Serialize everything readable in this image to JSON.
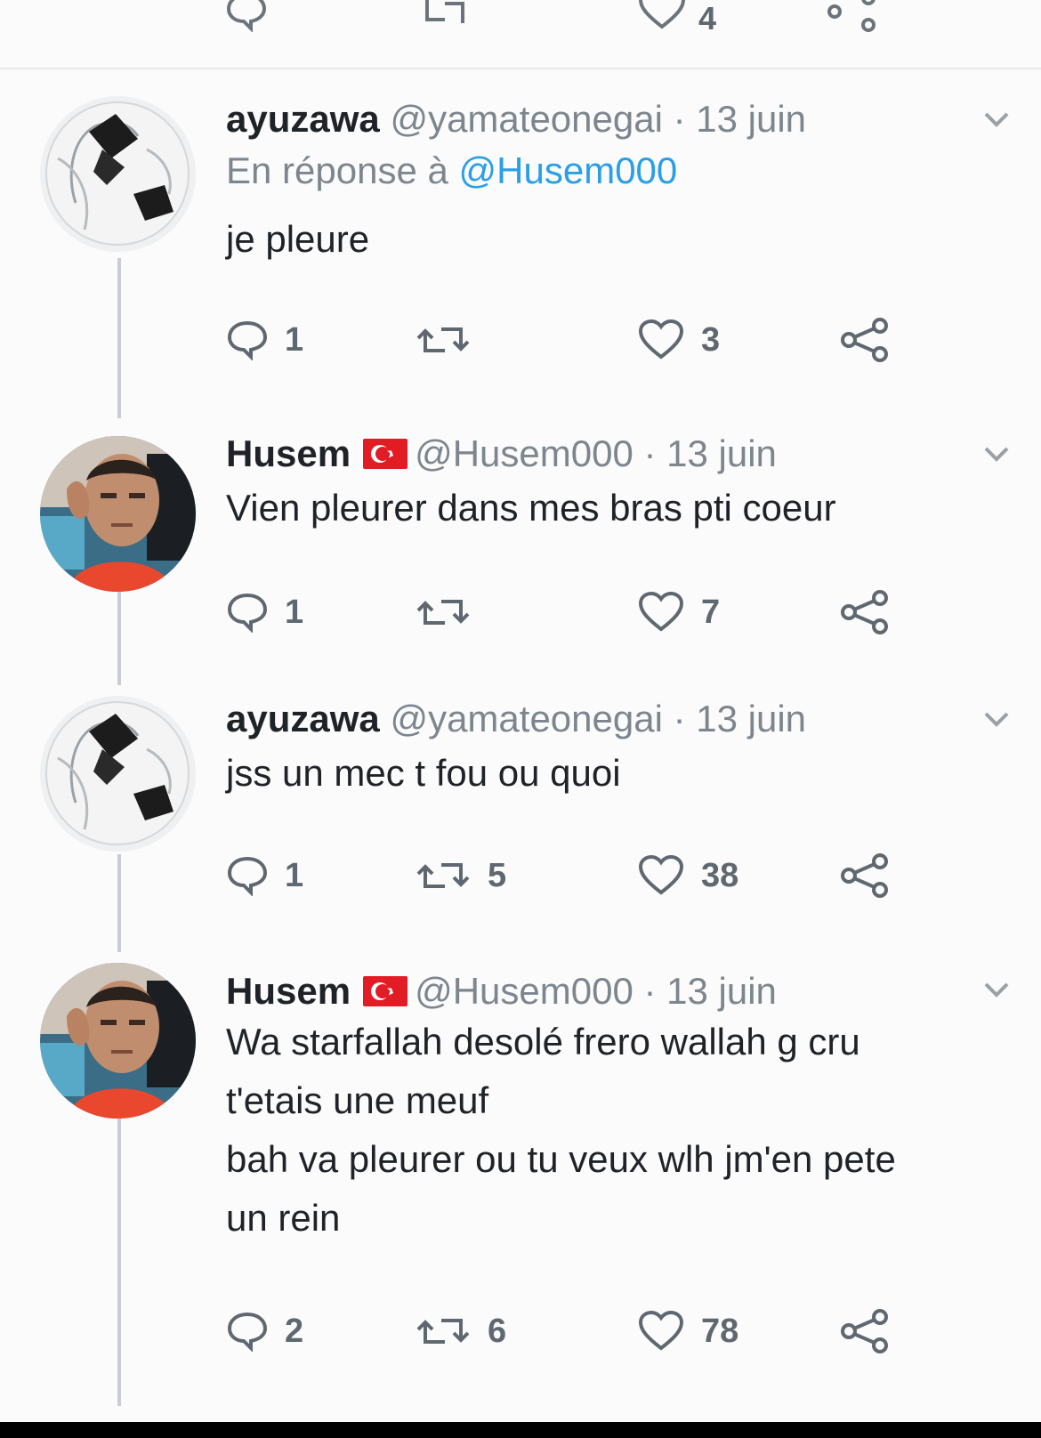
{
  "colors": {
    "text": "#1f2328",
    "muted": "#7d868e",
    "mention": "#2a9fe8",
    "thread_line": "#c9cdd1",
    "flag_red": "#e21c24"
  },
  "top_actions": {
    "like_count": "4"
  },
  "tweets": [
    {
      "name": "ayuzawa",
      "handle": "@yamateonegai",
      "date": "· 13 juin",
      "reply_prefix": "En réponse à",
      "reply_mention": "@Husem000",
      "text": "je pleure",
      "reply_count": "1",
      "retweet_count": "",
      "like_count": "3",
      "avatar": "anime-avatar"
    },
    {
      "name": "Husem",
      "flag": "turkey-flag-icon",
      "handle": "@Husem000",
      "date": "· 13 juin",
      "text": "Vien pleurer dans mes bras pti coeur",
      "reply_count": "1",
      "retweet_count": "",
      "like_count": "7",
      "avatar": "selfie-avatar"
    },
    {
      "name": "ayuzawa",
      "handle": "@yamateonegai",
      "date": "· 13 juin",
      "text": "jss un mec t fou ou quoi",
      "reply_count": "1",
      "retweet_count": "5",
      "like_count": "38",
      "avatar": "anime-avatar"
    },
    {
      "name": "Husem",
      "flag": "turkey-flag-icon",
      "handle": "@Husem000",
      "date": "· 13 juin",
      "text": "Wa starfallah desolé frero wallah g cru\nt'etais une meuf\nbah va pleurer ou tu veux wlh jm'en pete\nun rein",
      "reply_count": "2",
      "retweet_count": "6",
      "like_count": "78",
      "avatar": "selfie-avatar"
    }
  ]
}
